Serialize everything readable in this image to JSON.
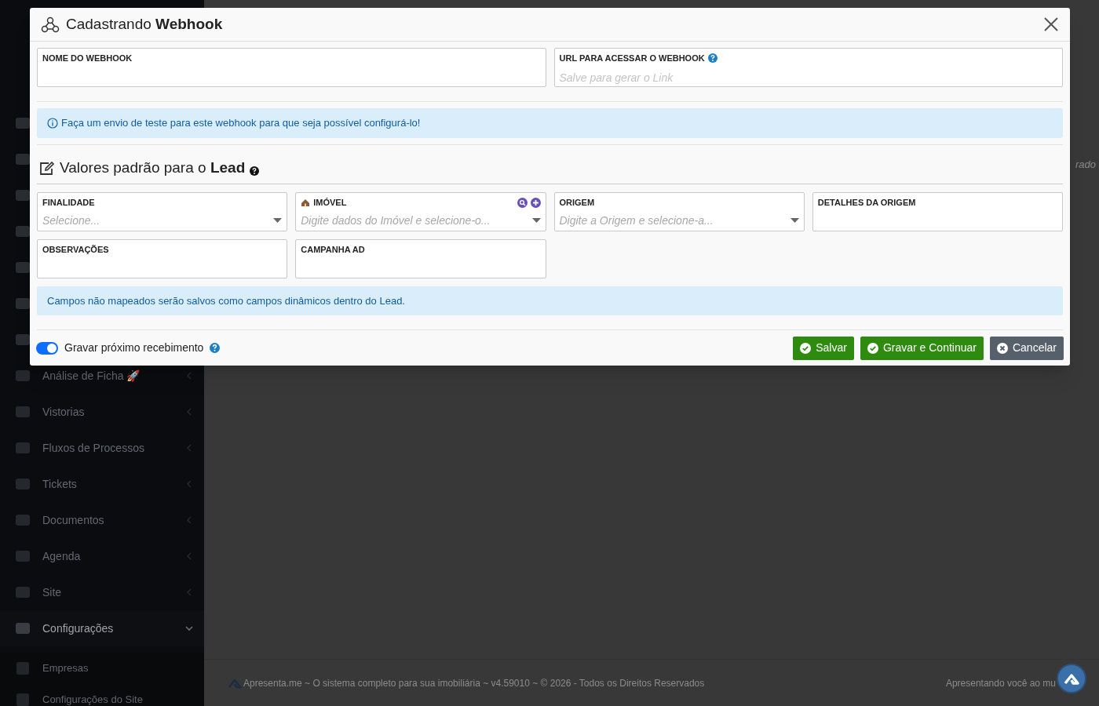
{
  "background": {
    "sidebar": {
      "items": [
        {
          "label": "Análise de Ficha 🚀",
          "expanded": false,
          "kind": "menu"
        },
        {
          "label": "Vistorias",
          "expanded": false,
          "kind": "menu"
        },
        {
          "label": "Fluxos de Processos",
          "expanded": false,
          "kind": "menu"
        },
        {
          "label": "Tickets",
          "expanded": false,
          "kind": "menu"
        },
        {
          "label": "Documentos",
          "expanded": false,
          "kind": "menu"
        },
        {
          "label": "Agenda",
          "expanded": false,
          "kind": "menu"
        },
        {
          "label": "Site",
          "expanded": false,
          "kind": "menu"
        },
        {
          "label": "Configurações",
          "expanded": true,
          "kind": "menu"
        },
        {
          "label": "Empresas",
          "kind": "submenu"
        },
        {
          "label": "Configurações do Site",
          "kind": "submenu"
        }
      ]
    },
    "side_text": "rado",
    "footer": {
      "left": "Apresenta.me ~ O sistema completo para sua imobiliária ~ v4.59010 ~ © 2026 - Todos os Direitos Reservados",
      "right": "Apresentando você ao mu"
    }
  },
  "modal": {
    "title": "Cadastrando **Webhook**",
    "top_fields": [
      {
        "label": "NOME DO WEBHOOK",
        "help": false
      },
      {
        "label": "URL PARA ACESSAR O WEBHOOK",
        "help": true,
        "placeholder": "Salve para gerar o Link"
      }
    ],
    "info_alert": "Faça um envio de teste para este webhook para que seja possível configurá-lo!",
    "section_title": "Valores padrão para o **Lead**",
    "lead_fields": [
      {
        "label": "FINALIDADE",
        "kind": "select",
        "placeholder": "Selecione..."
      },
      {
        "label": "IMÓVEL",
        "kind": "search_select",
        "placeholder": "Digite dados do Imóvel e selecione-o..."
      },
      {
        "label": "ORIGEM",
        "kind": "select",
        "placeholder": "Digite a Origem e selecione-a..."
      },
      {
        "label": "DETALHES DA ORIGEM",
        "kind": "text"
      },
      {
        "label": "OBSERVAÇÕES",
        "kind": "text"
      },
      {
        "label": "CAMPANHA AD",
        "kind": "text"
      }
    ],
    "note_alert": "Campos não mapeados serão salvos como campos dinâmicos dentro do Lead.",
    "toggle": {
      "label": "Gravar próximo recebimento",
      "on": true
    },
    "buttons": [
      {
        "label": "Salvar",
        "kind": "confirm"
      },
      {
        "label": "Gravar e Continuar",
        "kind": "confirm"
      },
      {
        "label": "Cancelar",
        "kind": "cancel"
      }
    ]
  }
}
